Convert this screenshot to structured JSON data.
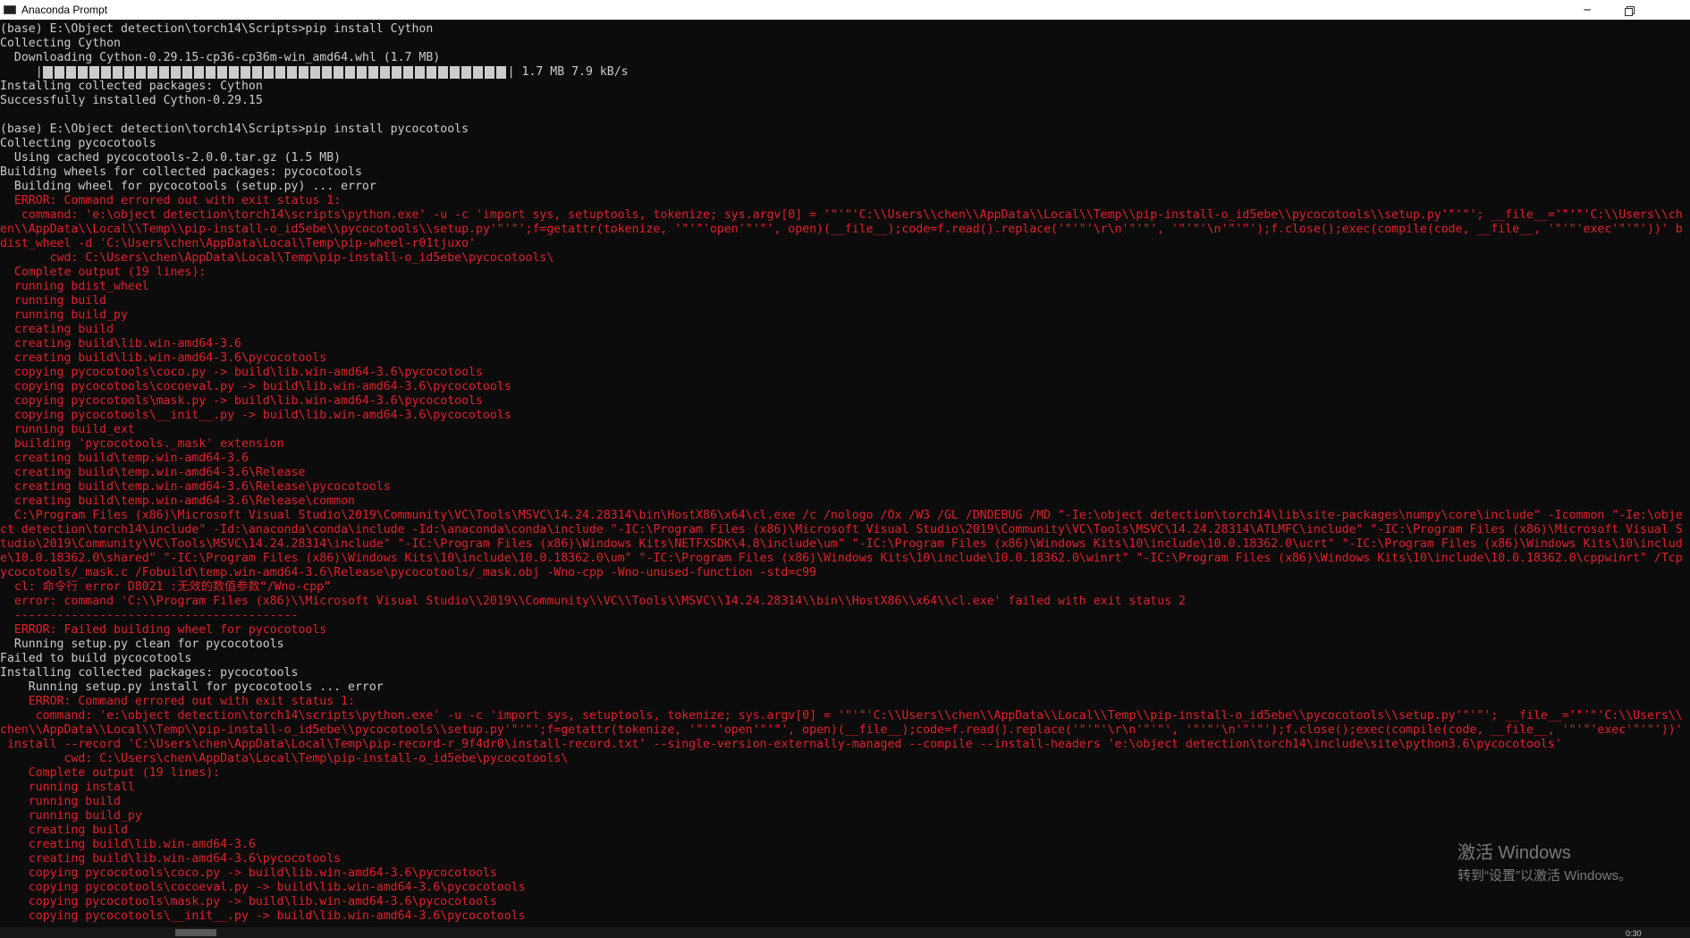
{
  "window": {
    "title": "Anaconda Prompt",
    "minimize_glyph": "─"
  },
  "colors": {
    "background": "#0c0c0c",
    "text": "#cccccc",
    "error": "#e0202a"
  },
  "console": {
    "lines": [
      {
        "text": "(base) E:\\Object detection\\torch14\\Scripts>pip install Cython",
        "color": "w"
      },
      {
        "text": "Collecting Cython",
        "color": "w"
      },
      {
        "text": "  Downloading Cython-0.29.15-cp36-cp36m-win_amd64.whl (1.7 MB)",
        "color": "w"
      },
      {
        "pre": "     |",
        "progress": 1.0,
        "post": "| 1.7 MB 7.9 kB/s",
        "color": "w"
      },
      {
        "text": "Installing collected packages: Cython",
        "color": "w"
      },
      {
        "text": "Successfully installed Cython-0.29.15",
        "color": "w"
      },
      {
        "text": "",
        "color": "w"
      },
      {
        "text": "(base) E:\\Object detection\\torch14\\Scripts>pip install pycocotools",
        "color": "w"
      },
      {
        "text": "Collecting pycocotools",
        "color": "w"
      },
      {
        "text": "  Using cached pycocotools-2.0.0.tar.gz (1.5 MB)",
        "color": "w"
      },
      {
        "text": "Building wheels for collected packages: pycocotools",
        "color": "w"
      },
      {
        "text": "  Building wheel for pycocotools (setup.py) ... error",
        "color": "w"
      },
      {
        "text": "  ERROR: Command errored out with exit status 1:",
        "color": "r"
      },
      {
        "text": "   command: 'e:\\object detection\\torch14\\scripts\\python.exe' -u -c 'import sys, setuptools, tokenize; sys.argv[0] = '\"'\"'C:\\\\Users\\\\chen\\\\AppData\\\\Local\\\\Temp\\\\pip-install-o_id5ebe\\\\pycocotools\\\\setup.py'\"'\"'; __file__='\"'\"'C:\\\\Users\\\\ch",
        "color": "r"
      },
      {
        "text": "en\\\\AppData\\\\Local\\\\Temp\\\\pip-install-o_id5ebe\\\\pycocotools\\\\setup.py'\"'\"';f=getattr(tokenize, '\"'\"'open'\"'\"', open)(__file__);code=f.read().replace('\"'\"'\\r\\n'\"'\"', '\"'\"'\\n'\"'\"');f.close();exec(compile(code, __file__, '\"'\"'exec'\"'\"'))' b",
        "color": "r"
      },
      {
        "text": "dist_wheel -d 'C:\\Users\\chen\\AppData\\Local\\Temp\\pip-wheel-r01tjuxo'",
        "color": "r"
      },
      {
        "text": "       cwd: C:\\Users\\chen\\AppData\\Local\\Temp\\pip-install-o_id5ebe\\pycocotools\\",
        "color": "r"
      },
      {
        "text": "  Complete output (19 lines):",
        "color": "r"
      },
      {
        "text": "  running bdist_wheel",
        "color": "r"
      },
      {
        "text": "  running build",
        "color": "r"
      },
      {
        "text": "  running build_py",
        "color": "r"
      },
      {
        "text": "  creating build",
        "color": "r"
      },
      {
        "text": "  creating build\\lib.win-amd64-3.6",
        "color": "r"
      },
      {
        "text": "  creating build\\lib.win-amd64-3.6\\pycocotools",
        "color": "r"
      },
      {
        "text": "  copying pycocotools\\coco.py -> build\\lib.win-amd64-3.6\\pycocotools",
        "color": "r"
      },
      {
        "text": "  copying pycocotools\\cocoeval.py -> build\\lib.win-amd64-3.6\\pycocotools",
        "color": "r"
      },
      {
        "text": "  copying pycocotools\\mask.py -> build\\lib.win-amd64-3.6\\pycocotools",
        "color": "r"
      },
      {
        "text": "  copying pycocotools\\__init__.py -> build\\lib.win-amd64-3.6\\pycocotools",
        "color": "r"
      },
      {
        "text": "  running build_ext",
        "color": "r"
      },
      {
        "text": "  building 'pycocotools._mask' extension",
        "color": "r"
      },
      {
        "text": "  creating build\\temp.win-amd64-3.6",
        "color": "r"
      },
      {
        "text": "  creating build\\temp.win-amd64-3.6\\Release",
        "color": "r"
      },
      {
        "text": "  creating build\\temp.win-amd64-3.6\\Release\\pycocotools",
        "color": "r"
      },
      {
        "text": "  creating build\\temp.win-amd64-3.6\\Release\\common",
        "color": "r"
      },
      {
        "text": "  C:\\Program Files (x86)\\Microsoft Visual Studio\\2019\\Community\\VC\\Tools\\MSVC\\14.24.28314\\bin\\HostX86\\x64\\cl.exe /c /nologo /Ox /W3 /GL /DNDEBUG /MD \"-Ie:\\object detection\\torch14\\lib\\site-packages\\numpy\\core\\include\" -Icommon \"-Ie:\\obje",
        "color": "r"
      },
      {
        "text": "ct detection\\torch14\\include\" -Id:\\anaconda\\conda\\include -Id:\\anaconda\\conda\\include \"-IC:\\Program Files (x86)\\Microsoft Visual Studio\\2019\\Community\\VC\\Tools\\MSVC\\14.24.28314\\ATLMFC\\include\" \"-IC:\\Program Files (x86)\\Microsoft Visual S",
        "color": "r"
      },
      {
        "text": "tudio\\2019\\Community\\VC\\Tools\\MSVC\\14.24.28314\\include\" \"-IC:\\Program Files (x86)\\Windows Kits\\NETFXSDK\\4.8\\include\\um\" \"-IC:\\Program Files (x86)\\Windows Kits\\10\\include\\10.0.18362.0\\ucrt\" \"-IC:\\Program Files (x86)\\Windows Kits\\10\\includ",
        "color": "r"
      },
      {
        "text": "e\\10.0.18362.0\\shared\" \"-IC:\\Program Files (x86)\\Windows Kits\\10\\include\\10.0.18362.0\\um\" \"-IC:\\Program Files (x86)\\Windows Kits\\10\\include\\10.0.18362.0\\winrt\" \"-IC:\\Program Files (x86)\\Windows Kits\\10\\include\\10.0.18362.0\\cppwinrt\" /Tcp",
        "color": "r"
      },
      {
        "text": "ycocotools/_mask.c /Fobuild\\temp.win-amd64-3.6\\Release\\pycocotools/_mask.obj -Wno-cpp -Wno-unused-function -std=c99",
        "color": "r"
      },
      {
        "text": "  cl: 命令行 error D8021 :无效的数值参数“/Wno-cpp”",
        "color": "r"
      },
      {
        "text": "  error: command 'C:\\\\Program Files (x86)\\\\Microsoft Visual Studio\\\\2019\\\\Community\\\\VC\\\\Tools\\\\MSVC\\\\14.24.28314\\\\bin\\\\HostX86\\\\x64\\\\cl.exe' failed with exit status 2",
        "color": "r"
      },
      {
        "text": "  ----------------------------------------",
        "color": "r"
      },
      {
        "text": "  ERROR: Failed building wheel for pycocotools",
        "color": "r"
      },
      {
        "text": "  Running setup.py clean for pycocotools",
        "color": "w"
      },
      {
        "text": "Failed to build pycocotools",
        "color": "w"
      },
      {
        "text": "Installing collected packages: pycocotools",
        "color": "w"
      },
      {
        "text": "    Running setup.py install for pycocotools ... error",
        "color": "w"
      },
      {
        "text": "    ERROR: Command errored out with exit status 1:",
        "color": "r"
      },
      {
        "text": "     command: 'e:\\object detection\\torch14\\scripts\\python.exe' -u -c 'import sys, setuptools, tokenize; sys.argv[0] = '\"'\"'C:\\\\Users\\\\chen\\\\AppData\\\\Local\\\\Temp\\\\pip-install-o_id5ebe\\\\pycocotools\\\\setup.py'\"'\"'; __file__='\"'\"'C:\\\\Users\\\\",
        "color": "r"
      },
      {
        "text": "chen\\\\AppData\\\\Local\\\\Temp\\\\pip-install-o_id5ebe\\\\pycocotools\\\\setup.py'\"'\"';f=getattr(tokenize, '\"'\"'open'\"'\"', open)(__file__);code=f.read().replace('\"'\"'\\r\\n'\"'\"', '\"'\"'\\n'\"'\"');f.close();exec(compile(code, __file__, '\"'\"'exec'\"'\"'))'",
        "color": "r"
      },
      {
        "text": " install --record 'C:\\Users\\chen\\AppData\\Local\\Temp\\pip-record-r_9f4dr0\\install-record.txt' --single-version-externally-managed --compile --install-headers 'e:\\object detection\\torch14\\include\\site\\python3.6\\pycocotools'",
        "color": "r"
      },
      {
        "text": "         cwd: C:\\Users\\chen\\AppData\\Local\\Temp\\pip-install-o_id5ebe\\pycocotools\\",
        "color": "r"
      },
      {
        "text": "    Complete output (19 lines):",
        "color": "r"
      },
      {
        "text": "    running install",
        "color": "r"
      },
      {
        "text": "    running build",
        "color": "r"
      },
      {
        "text": "    running build_py",
        "color": "r"
      },
      {
        "text": "    creating build",
        "color": "r"
      },
      {
        "text": "    creating build\\lib.win-amd64-3.6",
        "color": "r"
      },
      {
        "text": "    creating build\\lib.win-amd64-3.6\\pycocotools",
        "color": "r"
      },
      {
        "text": "    copying pycocotools\\coco.py -> build\\lib.win-amd64-3.6\\pycocotools",
        "color": "r"
      },
      {
        "text": "    copying pycocotools\\cocoeval.py -> build\\lib.win-amd64-3.6\\pycocotools",
        "color": "r"
      },
      {
        "text": "    copying pycocotools\\mask.py -> build\\lib.win-amd64-3.6\\pycocotools",
        "color": "r"
      },
      {
        "text": "    copying pycocotools\\__init__.py -> build\\lib.win-amd64-3.6\\pycocotools",
        "color": "r"
      }
    ]
  },
  "watermark": {
    "title": "激活 Windows",
    "subtitle": "转到“设置”以激活 Windows。"
  },
  "taskbar_clock_fragment": "0:30"
}
